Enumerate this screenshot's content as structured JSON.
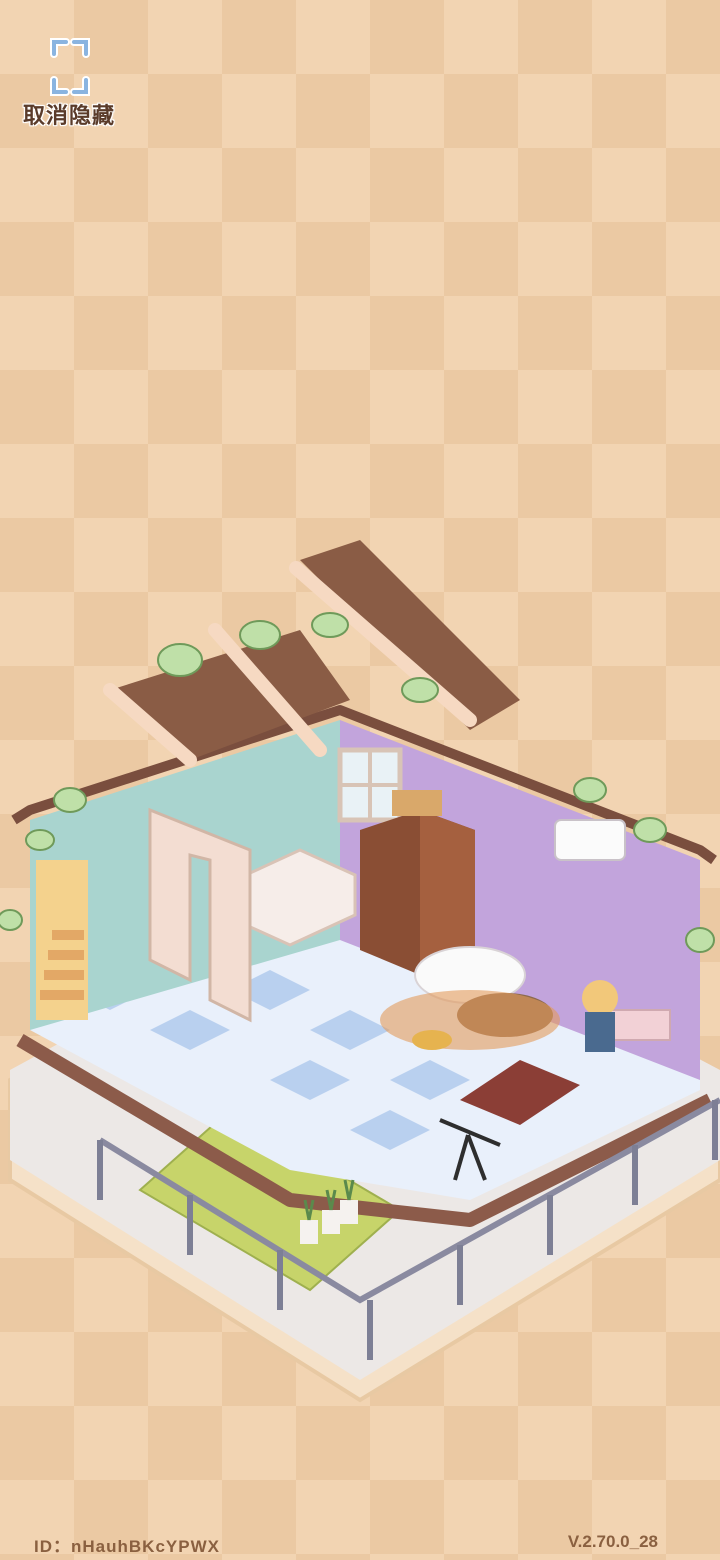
{
  "controls": {
    "restore_hidden_label": "取消隐藏"
  },
  "footer": {
    "player_id": "ID：nHauhBKcYPWX",
    "version": "V.2.70.0_28"
  },
  "icons": {
    "restore": "expand-frame-icon"
  },
  "colors": {
    "background_light": "#f2d4b2",
    "background_dark": "#ebc9a3",
    "label_text": "#5a3b2a",
    "footer_text": "#8a6040",
    "wall_blue": "#a9d4cf",
    "wall_purple": "#c2a4dc",
    "roof_tile": "#8a5c45",
    "floor_blue": "#b9d0ef"
  }
}
